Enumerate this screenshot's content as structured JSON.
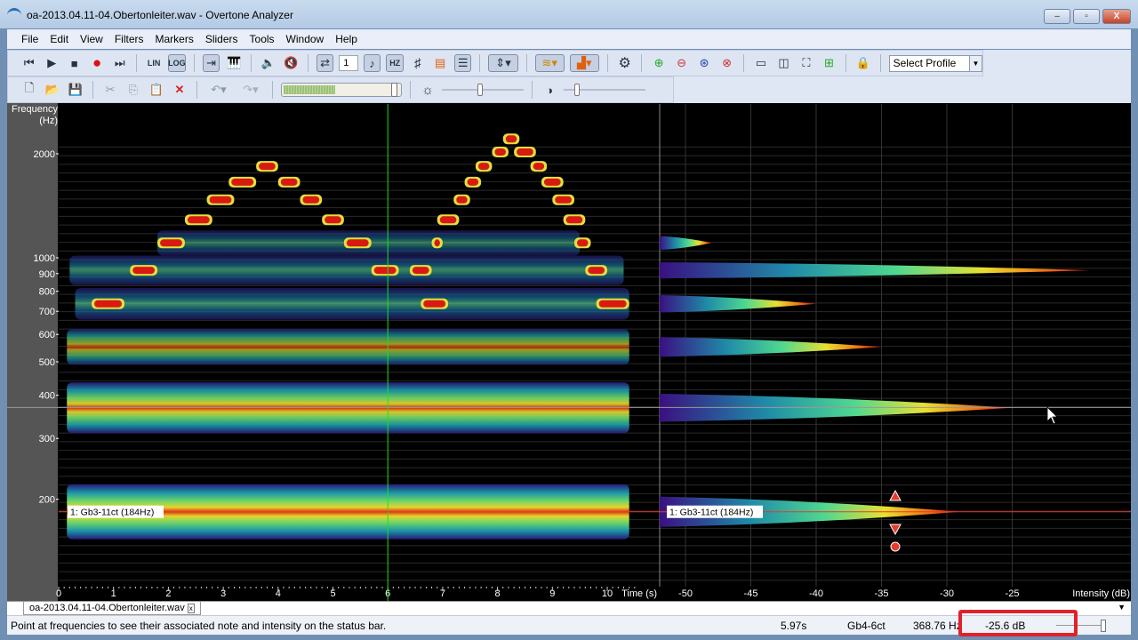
{
  "window": {
    "title": "oa-2013.04.11-04.Obertonleiter.wav - Overtone Analyzer",
    "minimize": "–",
    "maximize": "▫",
    "close": "X"
  },
  "menu": [
    "File",
    "Edit",
    "View",
    "Filters",
    "Markers",
    "Sliders",
    "Tools",
    "Window",
    "Help"
  ],
  "toolbar": {
    "lin": "LIN",
    "log": "LOG",
    "step_value": "1",
    "hz": "HZ",
    "sharp": "♯",
    "profile_select": "Select Profile"
  },
  "tabs": [
    {
      "label": "oa-2013.04.11-04.Obertonleiter.wav",
      "close": "x"
    }
  ],
  "status": {
    "message": "Point at frequencies to see their associated note and intensity on the status bar.",
    "time": "5.97s",
    "note": "Gb4-6ct",
    "freq": "368.76 Hz",
    "intensity": "-25.6 dB"
  },
  "marker_label": "1: Gb3-11ct (184Hz)",
  "colors": {
    "cursor": "#22dd22",
    "marker": "#e83a2a",
    "highlight": "#e3202a"
  },
  "chart_data": {
    "type": "heatmap",
    "title": "Spectrogram",
    "ylabel": "Frequency\n(Hz)",
    "ylabel_lines": [
      "Frequency",
      "(Hz)"
    ],
    "xlabel": "Time (s)",
    "x2label": "Intensity (dB)",
    "y_ticks": [
      2000,
      1000,
      900,
      800,
      700,
      600,
      500,
      400,
      300,
      200
    ],
    "x_ticks": [
      0,
      1,
      2,
      3,
      4,
      5,
      6,
      7,
      8,
      9,
      10
    ],
    "x2_ticks": [
      -50,
      -45,
      -40,
      -35,
      -30,
      -25
    ],
    "xlim": [
      0,
      10.5
    ],
    "ylim_hz": [
      115,
      2650
    ],
    "x2lim": [
      -52,
      -21
    ],
    "cursor_time": 6,
    "cursor_freq": 368.76,
    "marker_freq": 184,
    "harmonics": [
      {
        "freq": 184,
        "start": 0.15,
        "end": 10.4,
        "intensity": 1.0,
        "peak_db": -29
      },
      {
        "freq": 368,
        "start": 0.15,
        "end": 10.4,
        "intensity": 0.9,
        "peak_db": -25
      },
      {
        "freq": 552,
        "start": 0.15,
        "end": 10.4,
        "intensity": 0.55,
        "peak_db": -35
      },
      {
        "freq": 736,
        "start": 0.3,
        "end": 10.4,
        "intensity": 0.45,
        "peak_db": -40
      },
      {
        "freq": 920,
        "start": 0.2,
        "end": 10.3,
        "intensity": 0.4,
        "peak_db": -19
      },
      {
        "freq": 1104,
        "start": 1.8,
        "end": 9.5,
        "intensity": 0.3,
        "peak_db": -48
      }
    ],
    "overtone_notes": [
      {
        "t": 0.6,
        "end": 1.2,
        "freq": 736
      },
      {
        "t": 1.3,
        "end": 1.8,
        "freq": 920
      },
      {
        "t": 1.8,
        "end": 2.3,
        "freq": 1104
      },
      {
        "t": 2.3,
        "end": 2.8,
        "freq": 1288
      },
      {
        "t": 2.7,
        "end": 3.2,
        "freq": 1472
      },
      {
        "t": 3.1,
        "end": 3.6,
        "freq": 1656
      },
      {
        "t": 3.6,
        "end": 4.0,
        "freq": 1840
      },
      {
        "t": 4.0,
        "end": 4.4,
        "freq": 1656
      },
      {
        "t": 4.4,
        "end": 4.8,
        "freq": 1472
      },
      {
        "t": 4.8,
        "end": 5.2,
        "freq": 1288
      },
      {
        "t": 5.2,
        "end": 5.7,
        "freq": 1104
      },
      {
        "t": 5.7,
        "end": 6.2,
        "freq": 920
      },
      {
        "t": 6.4,
        "end": 6.8,
        "freq": 920
      },
      {
        "t": 6.8,
        "end": 7.0,
        "freq": 1104
      },
      {
        "t": 6.9,
        "end": 7.3,
        "freq": 1288
      },
      {
        "t": 7.2,
        "end": 7.5,
        "freq": 1472
      },
      {
        "t": 7.4,
        "end": 7.7,
        "freq": 1656
      },
      {
        "t": 7.6,
        "end": 7.9,
        "freq": 1840
      },
      {
        "t": 7.9,
        "end": 8.2,
        "freq": 2024
      },
      {
        "t": 8.1,
        "end": 8.4,
        "freq": 2208
      },
      {
        "t": 8.3,
        "end": 8.7,
        "freq": 2024
      },
      {
        "t": 8.6,
        "end": 8.9,
        "freq": 1840
      },
      {
        "t": 8.8,
        "end": 9.2,
        "freq": 1656
      },
      {
        "t": 9.0,
        "end": 9.4,
        "freq": 1472
      },
      {
        "t": 9.2,
        "end": 9.6,
        "freq": 1288
      },
      {
        "t": 9.4,
        "end": 9.7,
        "freq": 1104
      },
      {
        "t": 9.6,
        "end": 10.0,
        "freq": 920
      },
      {
        "t": 6.6,
        "end": 7.1,
        "freq": 736
      },
      {
        "t": 9.8,
        "end": 10.4,
        "freq": 736
      }
    ]
  }
}
